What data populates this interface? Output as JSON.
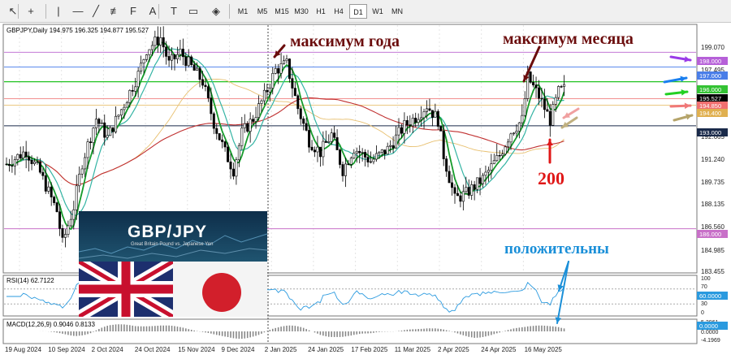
{
  "toolbar": {
    "tools": [
      {
        "name": "cursor",
        "glyph": "↖"
      },
      {
        "name": "crosshair",
        "glyph": "+"
      },
      {
        "name": "vertical-line",
        "glyph": "|"
      },
      {
        "name": "horizontal-line",
        "glyph": "—"
      },
      {
        "name": "trendline",
        "glyph": "╱"
      },
      {
        "name": "equidistant-channel",
        "glyph": "≢"
      },
      {
        "name": "fibonacci",
        "glyph": "F"
      },
      {
        "name": "text",
        "glyph": "A"
      },
      {
        "name": "label",
        "glyph": "T"
      },
      {
        "name": "rectangle",
        "glyph": "▭"
      },
      {
        "name": "shapes",
        "glyph": "◈"
      }
    ],
    "timeframes": [
      "M1",
      "M5",
      "M15",
      "M30",
      "H1",
      "H4",
      "D1",
      "W1",
      "MN"
    ],
    "active_timeframe": "D1"
  },
  "chart": {
    "header": "GBPJPY,Daily  194.975 196.325 194.877 195.527",
    "price_axis_ticks": [
      "199.070",
      "197.495",
      "195.527",
      "194.400",
      "192.665",
      "191.240",
      "189.735",
      "188.135",
      "186.560",
      "184.985",
      "183.455"
    ],
    "price_labels": [
      {
        "text": "198.000",
        "color": "#b660d8"
      },
      {
        "text": "197.000",
        "color": "#4a7ee8"
      },
      {
        "text": "196.000",
        "color": "#33c233"
      },
      {
        "text": "195.527",
        "color": "#000000"
      },
      {
        "text": "194.850",
        "color": "#f07070"
      },
      {
        "text": "194.400",
        "color": "#e0b050"
      },
      {
        "text": "193.000",
        "color": "#1a2a4a"
      },
      {
        "text": "186.000",
        "color": "#c870c8"
      }
    ],
    "date_labels": [
      "19 Aug 2024",
      "10 Sep 2024",
      "2 Oct 2024",
      "24 Oct 2024",
      "15 Nov 2024",
      "9 Dec 2024",
      "2 Jan 2025",
      "24 Jan 2025",
      "17 Feb 2025",
      "11 Mar 2025",
      "2 Apr 2025",
      "24 Apr 2025",
      "16 May 2025"
    ],
    "rsi": {
      "label": "RSI(14) 62.7122",
      "ticks": [
        "100",
        "70",
        "30",
        "0"
      ],
      "value_label": "60.0000"
    },
    "macd": {
      "label": "MACD(12,26,9) 0.9046 0.8133",
      "ticks": [
        "5.3961",
        "0.0000",
        "-4.1969"
      ],
      "value_label": "0.0000"
    }
  },
  "annotations": {
    "year_high": "максимум года",
    "month_high": "максимум месяца",
    "ma200": "200",
    "positive": "положительны"
  },
  "banner": {
    "title": "GBP/JPY",
    "subtitle": "Great Britain Pound vs. Japanese Yen"
  }
}
